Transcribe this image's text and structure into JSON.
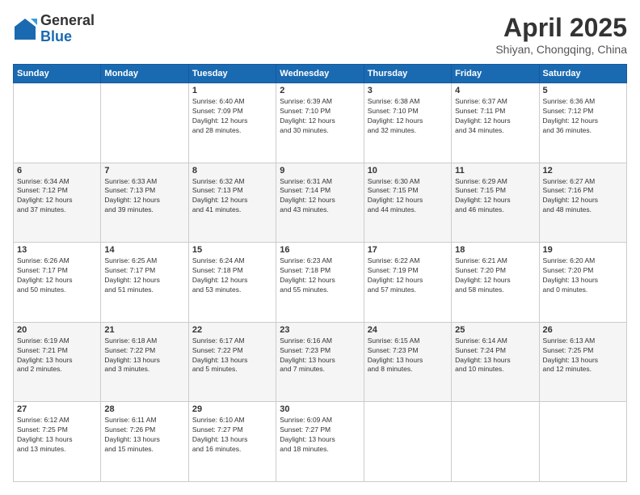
{
  "header": {
    "logo_general": "General",
    "logo_blue": "Blue",
    "month": "April 2025",
    "location": "Shiyan, Chongqing, China"
  },
  "days_of_week": [
    "Sunday",
    "Monday",
    "Tuesday",
    "Wednesday",
    "Thursday",
    "Friday",
    "Saturday"
  ],
  "weeks": [
    [
      {
        "day": "",
        "info": ""
      },
      {
        "day": "",
        "info": ""
      },
      {
        "day": "1",
        "info": "Sunrise: 6:40 AM\nSunset: 7:09 PM\nDaylight: 12 hours\nand 28 minutes."
      },
      {
        "day": "2",
        "info": "Sunrise: 6:39 AM\nSunset: 7:10 PM\nDaylight: 12 hours\nand 30 minutes."
      },
      {
        "day": "3",
        "info": "Sunrise: 6:38 AM\nSunset: 7:10 PM\nDaylight: 12 hours\nand 32 minutes."
      },
      {
        "day": "4",
        "info": "Sunrise: 6:37 AM\nSunset: 7:11 PM\nDaylight: 12 hours\nand 34 minutes."
      },
      {
        "day": "5",
        "info": "Sunrise: 6:36 AM\nSunset: 7:12 PM\nDaylight: 12 hours\nand 36 minutes."
      }
    ],
    [
      {
        "day": "6",
        "info": "Sunrise: 6:34 AM\nSunset: 7:12 PM\nDaylight: 12 hours\nand 37 minutes."
      },
      {
        "day": "7",
        "info": "Sunrise: 6:33 AM\nSunset: 7:13 PM\nDaylight: 12 hours\nand 39 minutes."
      },
      {
        "day": "8",
        "info": "Sunrise: 6:32 AM\nSunset: 7:13 PM\nDaylight: 12 hours\nand 41 minutes."
      },
      {
        "day": "9",
        "info": "Sunrise: 6:31 AM\nSunset: 7:14 PM\nDaylight: 12 hours\nand 43 minutes."
      },
      {
        "day": "10",
        "info": "Sunrise: 6:30 AM\nSunset: 7:15 PM\nDaylight: 12 hours\nand 44 minutes."
      },
      {
        "day": "11",
        "info": "Sunrise: 6:29 AM\nSunset: 7:15 PM\nDaylight: 12 hours\nand 46 minutes."
      },
      {
        "day": "12",
        "info": "Sunrise: 6:27 AM\nSunset: 7:16 PM\nDaylight: 12 hours\nand 48 minutes."
      }
    ],
    [
      {
        "day": "13",
        "info": "Sunrise: 6:26 AM\nSunset: 7:17 PM\nDaylight: 12 hours\nand 50 minutes."
      },
      {
        "day": "14",
        "info": "Sunrise: 6:25 AM\nSunset: 7:17 PM\nDaylight: 12 hours\nand 51 minutes."
      },
      {
        "day": "15",
        "info": "Sunrise: 6:24 AM\nSunset: 7:18 PM\nDaylight: 12 hours\nand 53 minutes."
      },
      {
        "day": "16",
        "info": "Sunrise: 6:23 AM\nSunset: 7:18 PM\nDaylight: 12 hours\nand 55 minutes."
      },
      {
        "day": "17",
        "info": "Sunrise: 6:22 AM\nSunset: 7:19 PM\nDaylight: 12 hours\nand 57 minutes."
      },
      {
        "day": "18",
        "info": "Sunrise: 6:21 AM\nSunset: 7:20 PM\nDaylight: 12 hours\nand 58 minutes."
      },
      {
        "day": "19",
        "info": "Sunrise: 6:20 AM\nSunset: 7:20 PM\nDaylight: 13 hours\nand 0 minutes."
      }
    ],
    [
      {
        "day": "20",
        "info": "Sunrise: 6:19 AM\nSunset: 7:21 PM\nDaylight: 13 hours\nand 2 minutes."
      },
      {
        "day": "21",
        "info": "Sunrise: 6:18 AM\nSunset: 7:22 PM\nDaylight: 13 hours\nand 3 minutes."
      },
      {
        "day": "22",
        "info": "Sunrise: 6:17 AM\nSunset: 7:22 PM\nDaylight: 13 hours\nand 5 minutes."
      },
      {
        "day": "23",
        "info": "Sunrise: 6:16 AM\nSunset: 7:23 PM\nDaylight: 13 hours\nand 7 minutes."
      },
      {
        "day": "24",
        "info": "Sunrise: 6:15 AM\nSunset: 7:23 PM\nDaylight: 13 hours\nand 8 minutes."
      },
      {
        "day": "25",
        "info": "Sunrise: 6:14 AM\nSunset: 7:24 PM\nDaylight: 13 hours\nand 10 minutes."
      },
      {
        "day": "26",
        "info": "Sunrise: 6:13 AM\nSunset: 7:25 PM\nDaylight: 13 hours\nand 12 minutes."
      }
    ],
    [
      {
        "day": "27",
        "info": "Sunrise: 6:12 AM\nSunset: 7:25 PM\nDaylight: 13 hours\nand 13 minutes."
      },
      {
        "day": "28",
        "info": "Sunrise: 6:11 AM\nSunset: 7:26 PM\nDaylight: 13 hours\nand 15 minutes."
      },
      {
        "day": "29",
        "info": "Sunrise: 6:10 AM\nSunset: 7:27 PM\nDaylight: 13 hours\nand 16 minutes."
      },
      {
        "day": "30",
        "info": "Sunrise: 6:09 AM\nSunset: 7:27 PM\nDaylight: 13 hours\nand 18 minutes."
      },
      {
        "day": "",
        "info": ""
      },
      {
        "day": "",
        "info": ""
      },
      {
        "day": "",
        "info": ""
      }
    ]
  ]
}
